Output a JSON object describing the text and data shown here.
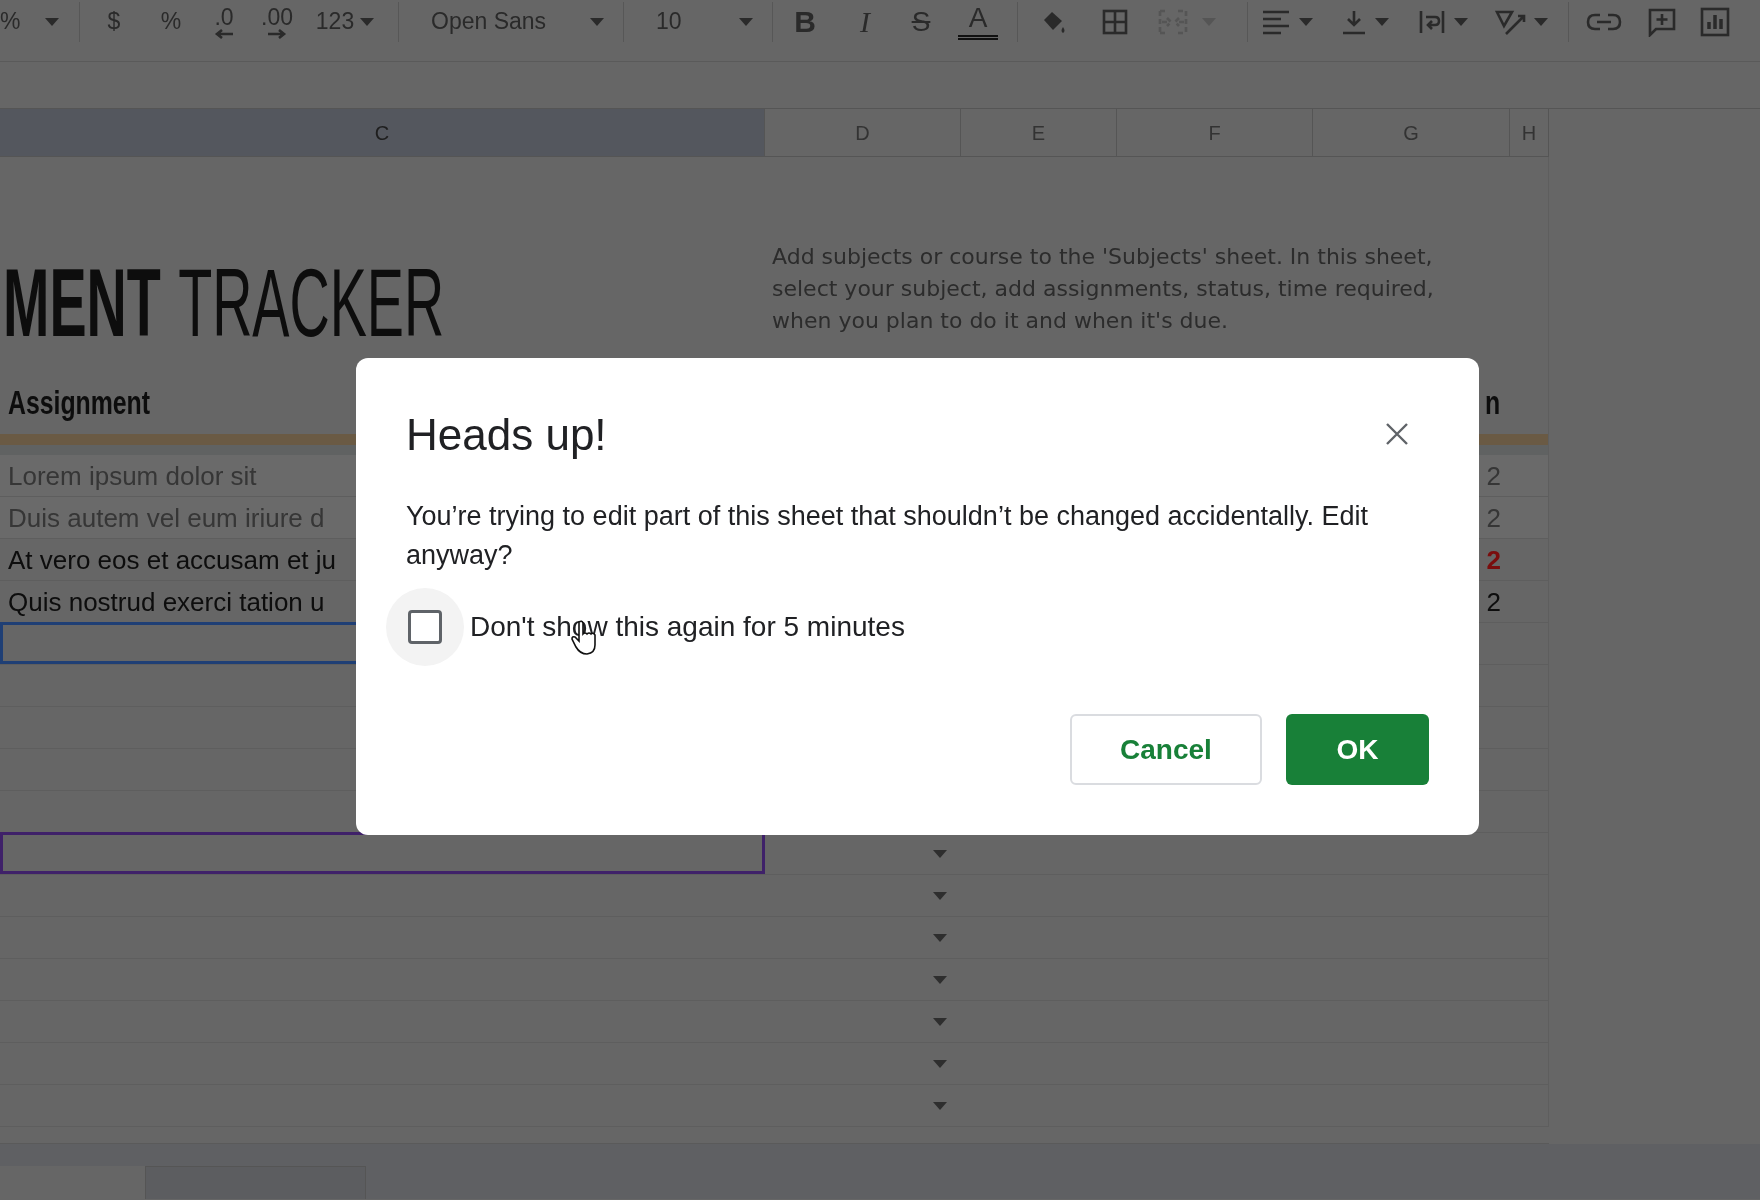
{
  "toolbar": {
    "zoom": "%",
    "currency": "$",
    "percent": "%",
    "decrease_decimals": ".0",
    "increase_decimals": ".00",
    "number_format": "123",
    "font": "Open Sans",
    "font_size": "10",
    "bold": "B",
    "italic": "I",
    "strikethrough": "S",
    "text_color": "A",
    "merge_disabled": true
  },
  "columns": [
    {
      "label": "C",
      "selected": true
    },
    {
      "label": "D",
      "selected": false
    },
    {
      "label": "E",
      "selected": false
    },
    {
      "label": "F",
      "selected": false
    },
    {
      "label": "G",
      "selected": false
    },
    {
      "label": "H",
      "selected": false
    }
  ],
  "title": {
    "bold_part": "MENT",
    "regular_part": "TRACKER"
  },
  "description": "Add subjects or course to the 'Subjects' sheet. In this sheet, select your subject, add assignments, status, time required, when you plan to do it and when it's due.",
  "header": {
    "assignment": "Assignment",
    "column_right": "n"
  },
  "rows": [
    {
      "assignment": "Lorem ipsum dolor sit",
      "date": "2",
      "completed": true,
      "overdue": false
    },
    {
      "assignment": "Duis autem vel eum iriure d",
      "date": "2",
      "completed": true,
      "overdue": false
    },
    {
      "assignment": "At vero eos et accusam et ju",
      "date": "2",
      "completed": false,
      "overdue": true
    },
    {
      "assignment": "Quis nostrud exerci tation u",
      "date": "2",
      "completed": false,
      "overdue": false
    }
  ],
  "empty_rows": [
    {
      "selected": true,
      "collaborator_cursor": false
    },
    {
      "selected": false,
      "collaborator_cursor": false
    },
    {
      "selected": false,
      "collaborator_cursor": false
    },
    {
      "selected": false,
      "collaborator_cursor": false
    },
    {
      "selected": false,
      "collaborator_cursor": false
    },
    {
      "selected": false,
      "collaborator_cursor": true,
      "dropdown": true
    },
    {
      "selected": false,
      "collaborator_cursor": false,
      "dropdown": true
    },
    {
      "selected": false,
      "collaborator_cursor": false,
      "dropdown": true
    },
    {
      "selected": false,
      "collaborator_cursor": false,
      "dropdown": true
    },
    {
      "selected": false,
      "collaborator_cursor": false,
      "dropdown": true
    },
    {
      "selected": false,
      "collaborator_cursor": false,
      "dropdown": true
    },
    {
      "selected": false,
      "collaborator_cursor": false,
      "dropdown": true
    }
  ],
  "sheet_tabs": [
    {
      "selected": true
    },
    {
      "selected": false
    }
  ],
  "dialog": {
    "title": "Heads up!",
    "message": "You’re trying to edit part of this sheet that shouldn’t be changed accidentally. Edit anyway?",
    "checkbox": {
      "label": "Don't show this again for 5 minutes",
      "checked": false
    },
    "buttons": [
      "Cancel",
      "OK"
    ]
  }
}
